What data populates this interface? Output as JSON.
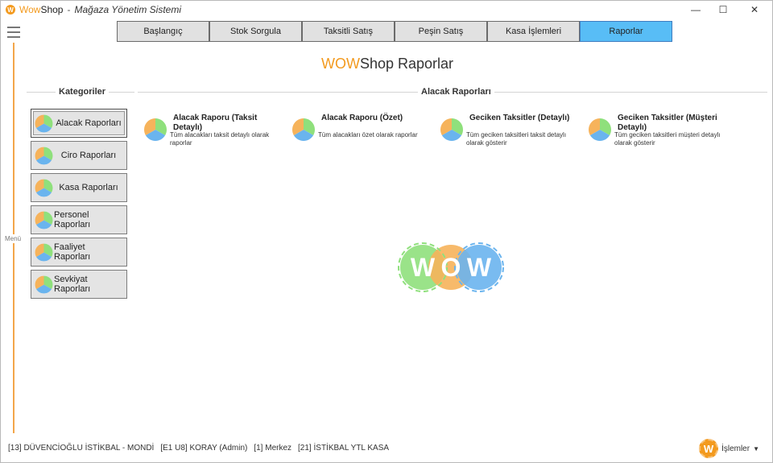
{
  "window": {
    "brand_prefix": "Wow",
    "brand_suffix": "Shop",
    "separator": "-",
    "subtitle": "Mağaza Yönetim Sistemi",
    "minimize": "—",
    "maximize": "☐",
    "close": "✕"
  },
  "rail": {
    "label": "Menü"
  },
  "tabs": [
    {
      "label": "Başlangıç",
      "active": false
    },
    {
      "label": "Stok Sorgula",
      "active": false
    },
    {
      "label": "Taksitli Satış",
      "active": false
    },
    {
      "label": "Peşin Satış",
      "active": false
    },
    {
      "label": "Kasa İşlemleri",
      "active": false
    },
    {
      "label": "Raporlar",
      "active": true
    }
  ],
  "page": {
    "title_prefix": "WOW",
    "title_suffix": "Shop Raporlar"
  },
  "categories": {
    "heading": "Kategoriler",
    "items": [
      {
        "label": "Alacak Raporları",
        "selected": true
      },
      {
        "label": "Ciro Raporları"
      },
      {
        "label": "Kasa Raporları"
      },
      {
        "label": "Personel Raporları"
      },
      {
        "label": "Faaliyet Raporları"
      },
      {
        "label": "Sevkiyat Raporları"
      }
    ]
  },
  "reports": {
    "heading": "Alacak Raporları",
    "items": [
      {
        "title": "Alacak Raporu (Taksit Detaylı)",
        "desc": "Tüm alacakları taksit detaylı olarak raporlar"
      },
      {
        "title": "Alacak Raporu (Özet)",
        "desc": "Tüm alacakları özet olarak raporlar"
      },
      {
        "title": "Geciken Taksitler (Detaylı)",
        "desc": "Tüm geciken taksitleri taksit detaylı olarak gösterir"
      },
      {
        "title": "Geciken Taksitler (Müşteri Detaylı)",
        "desc": "Tüm geciken taksitleri müşteri detaylı olarak gösterir"
      }
    ]
  },
  "logo": {
    "letters": [
      "W",
      "O",
      "W"
    ]
  },
  "status": {
    "store": "[13] DÜVENCİOĞLU İSTİKBAL - MONDİ",
    "user": "[E1 U8] KORAY  (Admin)",
    "branch": "[1] Merkez",
    "register": "[21] İSTİKBAL YTL KASA"
  },
  "actions": {
    "badge": "W",
    "label": "İşlemler",
    "caret": "▼"
  },
  "colors": {
    "accent_orange": "#f39a1e",
    "tab_active": "#58bdf6",
    "pie_orange": "#f6b35b",
    "pie_green": "#8fe07c",
    "pie_blue": "#6ab4ee"
  }
}
